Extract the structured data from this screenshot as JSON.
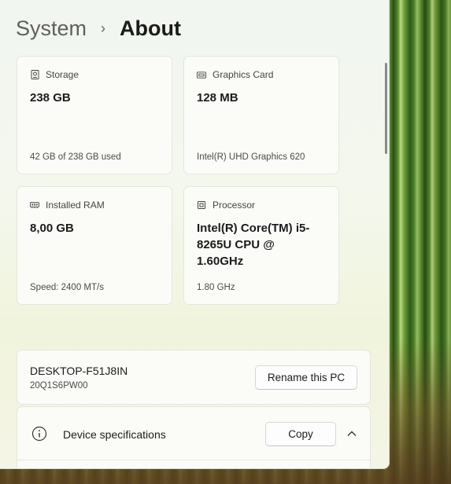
{
  "breadcrumb": {
    "parent": "System",
    "separator": "›",
    "current": "About"
  },
  "specs": [
    {
      "label": "Storage",
      "icon": "storage-icon",
      "value": "238 GB",
      "detail": "42 GB of 238 GB used"
    },
    {
      "label": "Graphics Card",
      "icon": "graphics-card-icon",
      "value": "128 MB",
      "detail": "Intel(R) UHD Graphics 620"
    },
    {
      "label": "Installed RAM",
      "icon": "ram-icon",
      "value": "8,00 GB",
      "detail": "Speed: 2400 MT/s"
    },
    {
      "label": "Processor",
      "icon": "processor-icon",
      "value": "Intel(R) Core(TM) i5-8265U CPU @ 1.60GHz",
      "detail": "1.80 GHz"
    }
  ],
  "pc": {
    "name": "DESKTOP-F51J8IN",
    "model": "20Q1S6PW00",
    "rename_label": "Rename this PC"
  },
  "device_specs": {
    "label": "Device specifications",
    "copy_label": "Copy"
  }
}
